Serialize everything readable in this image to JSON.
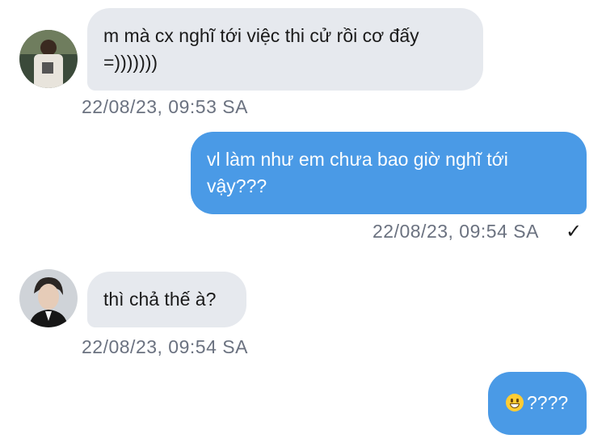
{
  "messages": [
    {
      "text": "m mà cx nghĩ tới việc thi cử rồi cơ đấy =)))))))",
      "timestamp": "22/08/23, 09:53 SA"
    },
    {
      "text": "vl làm như em chưa bao giờ nghĩ tới vậy???",
      "timestamp": "22/08/23, 09:54 SA",
      "status_icon": "✓"
    },
    {
      "text": "thì chả thế à?",
      "timestamp": "22/08/23, 09:54 SA"
    },
    {
      "text": "????",
      "emoji": "grinning-face"
    }
  ],
  "colors": {
    "incoming_bubble": "#e6e9ee",
    "outgoing_bubble": "#4a9ae6",
    "timestamp": "#6b7280"
  }
}
